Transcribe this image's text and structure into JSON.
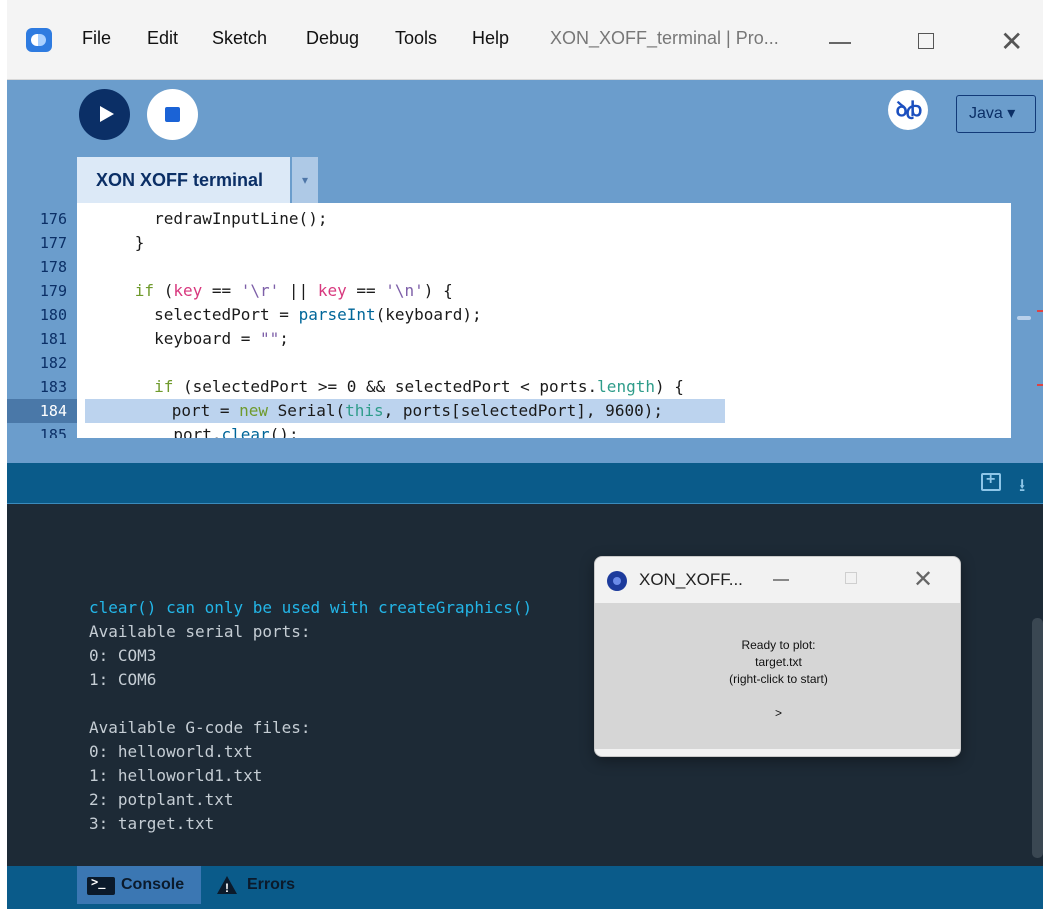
{
  "titlebar": {
    "menu": [
      "File",
      "Edit",
      "Sketch",
      "Debug",
      "Tools",
      "Help"
    ],
    "window_title": "XON_XOFF_terminal | Pro..."
  },
  "toolbar": {
    "mode_label": "Java ▾",
    "debug_label": "ꝺꞗ"
  },
  "editor": {
    "tab_label": "XON XOFF terminal",
    "tab_dropdown": "▾",
    "line_numbers": [
      "176",
      "177",
      "178",
      "179",
      "180",
      "181",
      "182",
      "183",
      "184",
      "185"
    ],
    "current_line": "184"
  },
  "console": {
    "lines": [
      "clear() can only be used with createGraphics()",
      "Available serial ports:",
      "0: COM3",
      "1: COM6",
      "",
      "Available G-code files:",
      "0: helloworld.txt",
      "1: helloworld1.txt",
      "2: potplant.txt",
      "3: target.txt"
    ]
  },
  "bottom_tabs": {
    "console": "Console",
    "errors": "Errors"
  },
  "sketch_window": {
    "title": "XON_XOFF...",
    "lines": [
      "Ready to plot:",
      "target.txt",
      "(right-click to start)",
      "",
      ">"
    ]
  },
  "colors": {
    "accent": "#6b9dcc",
    "navy": "#0b2f66",
    "console_bg": "#1d2a36",
    "status_bar": "#0a5b8a",
    "error_text": "#23b6e8"
  }
}
